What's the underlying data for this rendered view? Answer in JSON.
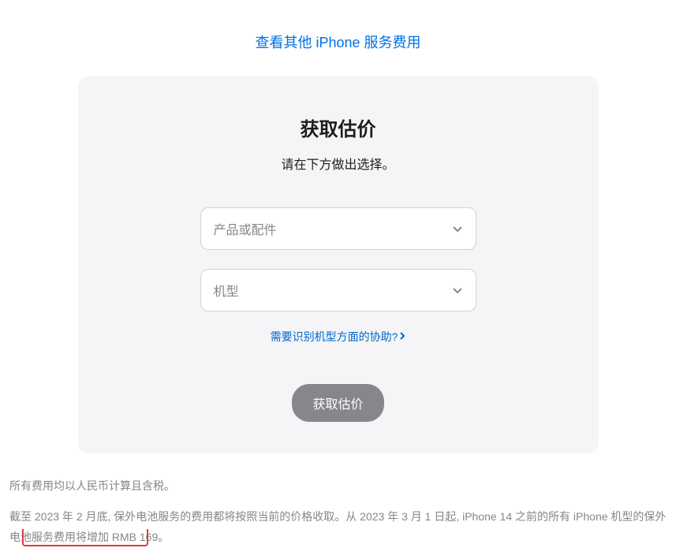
{
  "topLink": {
    "label": "查看其他 iPhone 服务费用"
  },
  "card": {
    "title": "获取估价",
    "subtitle": "请在下方做出选择。",
    "select1": {
      "placeholder": "产品或配件"
    },
    "select2": {
      "placeholder": "机型"
    },
    "helpLink": {
      "label": "需要识别机型方面的协助?"
    },
    "submit": {
      "label": "获取估价"
    }
  },
  "footer": {
    "note1": "所有费用均以人民币计算且含税。",
    "note2": "截至 2023 年 2 月底, 保外电池服务的费用都将按照当前的价格收取。从 2023 年 3 月 1 日起, iPhone 14 之前的所有 iPhone 机型的保外电池服务费用将增加 RMB 169。"
  }
}
